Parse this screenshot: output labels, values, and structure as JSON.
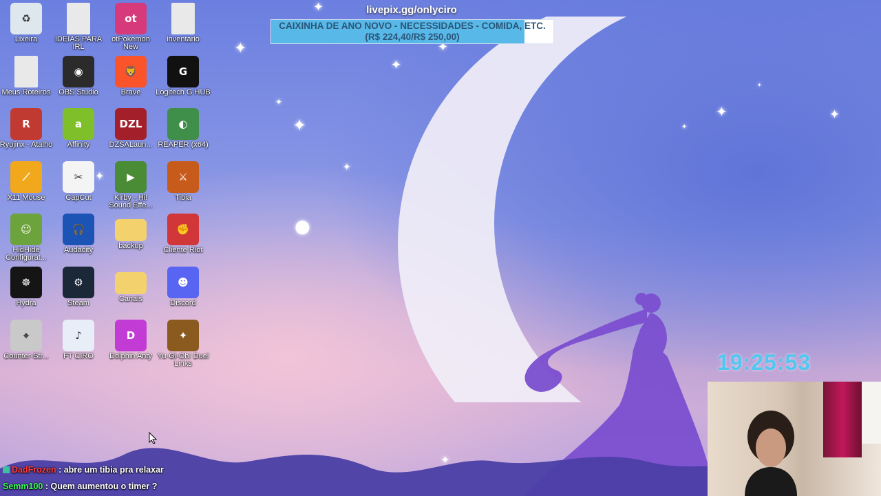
{
  "desktop": {
    "icons": [
      {
        "label": "Lixeira",
        "icon": "recycle-bin-icon",
        "color": "#dfe7ee",
        "glyph": "♻"
      },
      {
        "label": "IDEIAS PARA IRL",
        "icon": "text-file-icon",
        "color": "#e9e9e9",
        "glyph": ""
      },
      {
        "label": "otPokemon New",
        "icon": "otpokemon-icon",
        "color": "#d63a7a",
        "glyph": "ot"
      },
      {
        "label": "inventario",
        "icon": "text-file-icon",
        "color": "#e9e9e9",
        "glyph": ""
      },
      {
        "label": "Meus Roteiros",
        "icon": "text-file-icon",
        "color": "#e9e9e9",
        "glyph": ""
      },
      {
        "label": "OBS Studio",
        "icon": "obs-studio-icon",
        "color": "#2b2b2b",
        "glyph": "◉"
      },
      {
        "label": "Brave",
        "icon": "brave-browser-icon",
        "color": "#fb542b",
        "glyph": "🦁"
      },
      {
        "label": "Logitech G HUB",
        "icon": "logitech-g-hub-icon",
        "color": "#111111",
        "glyph": "G"
      },
      {
        "label": "Ryujinx - Atalho",
        "icon": "ryujinx-icon",
        "color": "#c03a32",
        "glyph": "R"
      },
      {
        "label": "Affinity",
        "icon": "affinity-icon",
        "color": "#7fbf2a",
        "glyph": "a"
      },
      {
        "label": "DZSALaun...",
        "icon": "dzsa-launcher-icon",
        "color": "#a3202a",
        "glyph": "DZL"
      },
      {
        "label": "REAPER (x64)",
        "icon": "reaper-icon",
        "color": "#3f8e4a",
        "glyph": "◐"
      },
      {
        "label": "X11 Mouse",
        "icon": "x11-mouse-icon",
        "color": "#f2a81d",
        "glyph": "⟋"
      },
      {
        "label": "CapCut",
        "icon": "capcut-icon",
        "color": "#f4f4f4",
        "glyph": "✂"
      },
      {
        "label": "Kirby - Hi! Sound Effe...",
        "icon": "video-file-icon",
        "color": "#4a8b36",
        "glyph": "▶"
      },
      {
        "label": "Tibia",
        "icon": "tibia-icon",
        "color": "#c75b1c",
        "glyph": "⚔"
      },
      {
        "label": "HidHide Configurat...",
        "icon": "hidhide-icon",
        "color": "#6da33c",
        "glyph": "☺"
      },
      {
        "label": "Audacity",
        "icon": "audacity-icon",
        "color": "#1b54b5",
        "glyph": "🎧"
      },
      {
        "label": "backup",
        "icon": "folder-icon",
        "color": "#f3d16c",
        "glyph": ""
      },
      {
        "label": "Cliente Riot",
        "icon": "riot-client-icon",
        "color": "#d13639",
        "glyph": "✊"
      },
      {
        "label": "Hydra",
        "icon": "hydra-icon",
        "color": "#151515",
        "glyph": "☸"
      },
      {
        "label": "Steam",
        "icon": "steam-icon",
        "color": "#1b2838",
        "glyph": "⚙"
      },
      {
        "label": "Canais",
        "icon": "folder-icon",
        "color": "#f3d16c",
        "glyph": ""
      },
      {
        "label": "Discord",
        "icon": "discord-icon",
        "color": "#5865f2",
        "glyph": "☻"
      },
      {
        "label": "Counter-Str...",
        "icon": "counter-strike-icon",
        "color": "#c9c9c9",
        "glyph": "⌖"
      },
      {
        "label": "FT CIRO",
        "icon": "wav-file-icon",
        "color": "#e7eef7",
        "glyph": "♪"
      },
      {
        "label": "Dolphin Anty",
        "icon": "dolphin-anty-icon",
        "color": "#c23bd4",
        "glyph": "D"
      },
      {
        "label": "Yu-Gi-Oh! Duel Links",
        "icon": "yugioh-duel-links-icon",
        "color": "#8a5a1e",
        "glyph": "✦"
      }
    ]
  },
  "donation_goal": {
    "url": "livepix.gg/onlyciro",
    "title": "CAIXINHA DE ANO NOVO - NECESSIDADES - COMIDA, ETC.",
    "amounts": "(R$ 224,40/R$ 250,00)",
    "progress_fraction": 0.8976,
    "fill_color": "#58b8e8"
  },
  "clock": {
    "time": "19:25:53",
    "color": "#52c7f0"
  },
  "chat": [
    {
      "user": "DadFrozen",
      "message": " : abre um tibia pra relaxar",
      "user_color": "#ff3b3b"
    },
    {
      "user": "Semm100",
      "message": " : Quem aumentou o timer ?",
      "user_color": "#3bff57"
    }
  ]
}
